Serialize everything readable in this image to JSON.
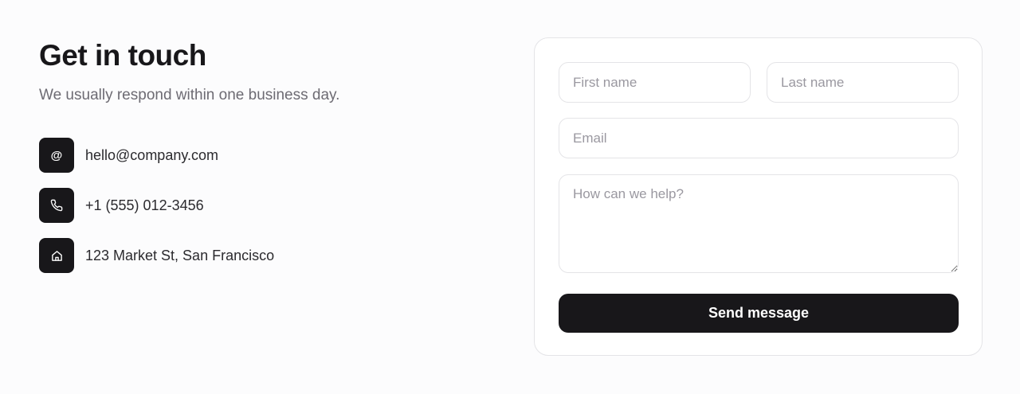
{
  "header": {
    "title": "Get in touch",
    "subtitle": "We usually respond within one business day."
  },
  "contacts": [
    {
      "icon": "at-icon",
      "glyph": "@",
      "text": "hello@company.com"
    },
    {
      "icon": "phone-icon",
      "text": "+1 (555) 012-3456"
    },
    {
      "icon": "home-icon",
      "text": "123 Market St, San Francisco"
    }
  ],
  "form": {
    "first_name": {
      "placeholder": "First name",
      "value": ""
    },
    "last_name": {
      "placeholder": "Last name",
      "value": ""
    },
    "email": {
      "placeholder": "Email",
      "value": ""
    },
    "message": {
      "placeholder": "How can we help?",
      "value": ""
    },
    "submit_label": "Send message"
  },
  "colors": {
    "accent": "#18171a",
    "muted_text": "#6d6b73",
    "border": "#e4e4e7",
    "background": "#fcfcfd"
  }
}
